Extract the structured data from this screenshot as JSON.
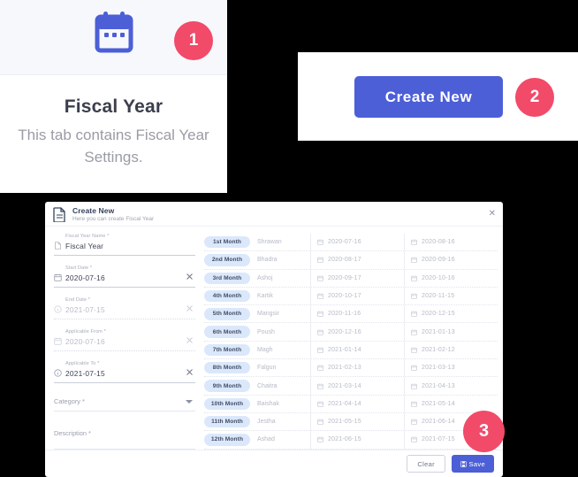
{
  "tab_card": {
    "icon": "calendar-icon",
    "title": "Fiscal Year",
    "description": "This tab contains Fiscal Year Settings."
  },
  "action_bar": {
    "create_label": "Create New"
  },
  "badges": [
    {
      "label": "1"
    },
    {
      "label": "2"
    },
    {
      "label": "3"
    }
  ],
  "colors": {
    "accent_blue": "#4c5fd7",
    "badge_pink": "#f24a69",
    "chip_blue": "#dbe8fb",
    "panel_grey": "#f7f8fc"
  },
  "dialog": {
    "icon": "document-icon",
    "title": "Create New",
    "subtitle": "Here you can create Fiscal Year",
    "close_label": "✕",
    "fields": [
      {
        "label": "Fiscal Year Name *",
        "value": "Fiscal Year",
        "icon": "document-icon",
        "clearable": false,
        "muted": false,
        "underline": "solid"
      },
      {
        "label": "Start Date *",
        "value": "2020-07-16",
        "icon": "calendar-icon",
        "clearable": true,
        "muted": false,
        "underline": "solid"
      },
      {
        "label": "End Date *",
        "value": "2021-07-15",
        "icon": "info-icon",
        "clearable": true,
        "muted": true,
        "underline": "dotted"
      },
      {
        "label": "Applicable From *",
        "value": "2020-07-16",
        "icon": "calendar-icon",
        "clearable": true,
        "muted": true,
        "underline": "dotted"
      },
      {
        "label": "Applicable To *",
        "value": "2021-07-15",
        "icon": "info-icon",
        "clearable": true,
        "muted": false,
        "underline": "solid"
      }
    ],
    "category": {
      "label": "Category *",
      "value": "",
      "icon": "chevron-down-icon"
    },
    "description": {
      "label": "Description *",
      "value": ""
    },
    "table": {
      "rows": [
        {
          "month": "1st Month",
          "name": "Shrawan",
          "start": "2020-07-16",
          "end": "2020-08-16"
        },
        {
          "month": "2nd Month",
          "name": "Bhadra",
          "start": "2020-08-17",
          "end": "2020-09-16"
        },
        {
          "month": "3rd Month",
          "name": "Ashoj",
          "start": "2020-09-17",
          "end": "2020-10-16"
        },
        {
          "month": "4th Month",
          "name": "Kartik",
          "start": "2020-10-17",
          "end": "2020-11-15"
        },
        {
          "month": "5th Month",
          "name": "Mangsir",
          "start": "2020-11-16",
          "end": "2020-12-15"
        },
        {
          "month": "6th Month",
          "name": "Poush",
          "start": "2020-12-16",
          "end": "2021-01-13"
        },
        {
          "month": "7th Month",
          "name": "Magh",
          "start": "2021-01-14",
          "end": "2021-02-12"
        },
        {
          "month": "8th Month",
          "name": "Falgun",
          "start": "2021-02-13",
          "end": "2021-03-13"
        },
        {
          "month": "9th Month",
          "name": "Chaitra",
          "start": "2021-03-14",
          "end": "2021-04-13"
        },
        {
          "month": "10th Month",
          "name": "Baishak",
          "start": "2021-04-14",
          "end": "2021-05-14"
        },
        {
          "month": "11th Month",
          "name": "Jestha",
          "start": "2021-05-15",
          "end": "2021-06-14"
        },
        {
          "month": "12th Month",
          "name": "Ashad",
          "start": "2021-06-15",
          "end": "2021-07-15"
        }
      ]
    },
    "footer": {
      "clear_label": "Clear",
      "save_label": "Save",
      "save_icon": "floppy-save-icon"
    }
  }
}
